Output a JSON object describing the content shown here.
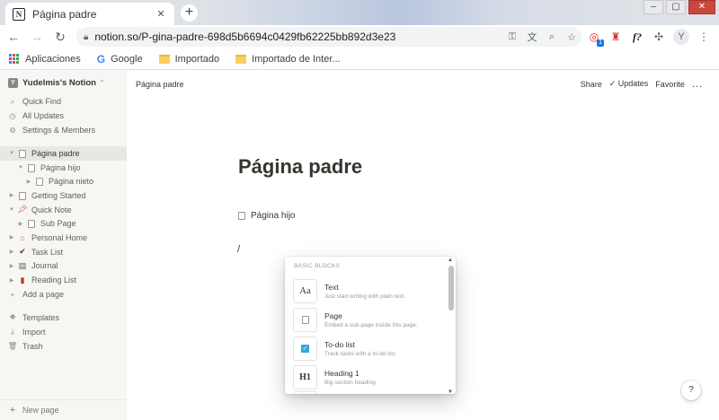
{
  "browser": {
    "tab_title": "Página padre",
    "tab_favicon": "N",
    "new_tab_label": "+",
    "url": "notion.so/P-gina-padre-698d5b6694c0429fb62225bb892d3e23",
    "extension_badge": "1",
    "extension_text": "f?",
    "profile_initial": "Y",
    "bookmarks": [
      {
        "label": "Aplicaciones",
        "icon": "apps-grid-icon"
      },
      {
        "label": "Google",
        "icon": "google-icon"
      },
      {
        "label": "Importado",
        "icon": "folder-icon"
      },
      {
        "label": "Importado de Inter...",
        "icon": "folder-icon"
      }
    ]
  },
  "sidebar": {
    "workspace": "Yudelmis's Notion",
    "workspace_initial": "Y",
    "top_items": [
      {
        "label": "Quick Find",
        "icon": "search-icon"
      },
      {
        "label": "All Updates",
        "icon": "clock-icon"
      },
      {
        "label": "Settings & Members",
        "icon": "gear-icon"
      }
    ],
    "pages": [
      {
        "label": "Página padre",
        "icon": "page-icon"
      },
      {
        "label": "Página hijo",
        "icon": "page-icon"
      },
      {
        "label": "Página nieto",
        "icon": "page-icon"
      },
      {
        "label": "Getting Started",
        "icon": "page-icon"
      },
      {
        "label": "Quick Note",
        "icon": "pin-icon"
      },
      {
        "label": "Sub Page",
        "icon": "page-icon"
      },
      {
        "label": "Personal Home",
        "icon": "house-icon"
      },
      {
        "label": "Task List",
        "icon": "check-icon"
      },
      {
        "label": "Journal",
        "icon": "notebook-icon"
      },
      {
        "label": "Reading List",
        "icon": "book-icon"
      }
    ],
    "add_page": "Add a page",
    "bottom_items": [
      {
        "label": "Templates",
        "icon": "templates-icon"
      },
      {
        "label": "Import",
        "icon": "import-icon"
      },
      {
        "label": "Trash",
        "icon": "trash-icon"
      }
    ],
    "new_page": "New page"
  },
  "main": {
    "breadcrumb": "Página padre",
    "actions": {
      "share": "Share",
      "updates": "Updates",
      "favorite": "Favorite",
      "more": "..."
    },
    "title": "Página padre",
    "child_page": "Página hijo",
    "slash_text": "/",
    "help": "?"
  },
  "slash_menu": {
    "section": "BASIC BLOCKS",
    "items": [
      {
        "name": "Text",
        "desc": "Just start writing with plain text.",
        "thumb": "Aa"
      },
      {
        "name": "Page",
        "desc": "Embed a sub-page inside this page.",
        "thumb": "page-icon"
      },
      {
        "name": "To-do list",
        "desc": "Track tasks with a to-do list.",
        "thumb": "checkbox-icon"
      },
      {
        "name": "Heading 1",
        "desc": "Big section heading.",
        "thumb": "H1"
      }
    ]
  },
  "colors": {
    "sidebar_bg": "#f7f6f3",
    "active_row": "#e8e7e3",
    "text": "#37352f",
    "todo_accent": "#2eaadc",
    "chrome_bg": "#dee1e6"
  }
}
